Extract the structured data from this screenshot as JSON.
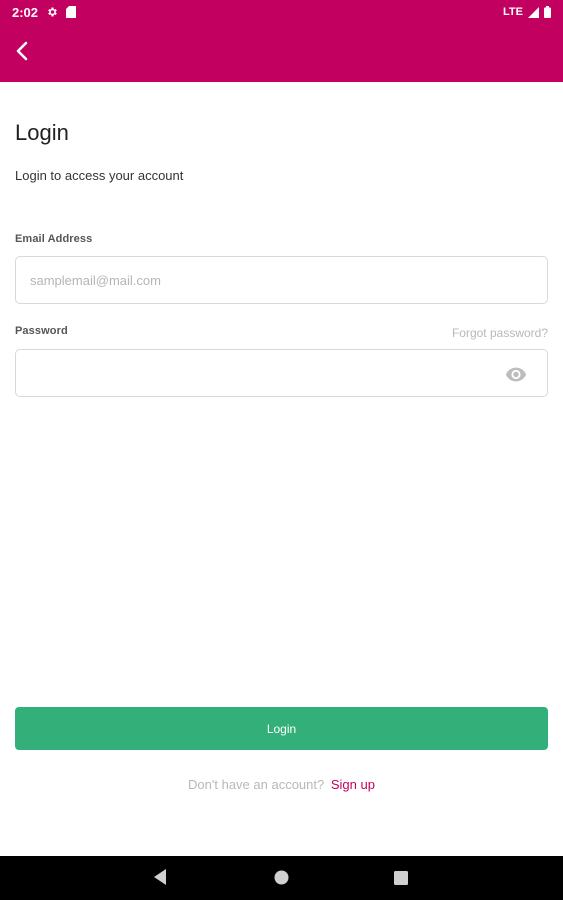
{
  "status_bar": {
    "time": "2:02",
    "network": "LTE"
  },
  "header": {
    "back_icon": "chevron-left-icon"
  },
  "page": {
    "title": "Login",
    "subtitle": "Login to access your account"
  },
  "form": {
    "email_label": "Email Address",
    "email_placeholder": "samplemail@mail.com",
    "email_value": "",
    "password_label": "Password",
    "password_value": "",
    "forgot_password": "Forgot password?",
    "password_visibility_icon": "eye-icon"
  },
  "actions": {
    "login_label": "Login",
    "signup_prompt": "Don't have an account?",
    "signup_link": "Sign up"
  },
  "colors": {
    "primary": "#c2005f",
    "button": "#33b07a",
    "muted_text": "#b8b8b8",
    "nav_bar": "#000000"
  }
}
